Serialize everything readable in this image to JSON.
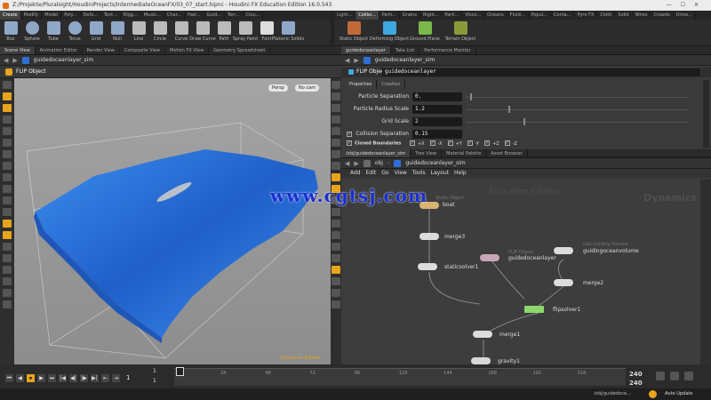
{
  "window": {
    "title": "Z:/Projekte/Pluralsight/HoudiniProjects/IntermediateOceanFX/03_07_start.hipnc - Houdini FX Education Edition 16.0.543"
  },
  "left_shelf": {
    "tabs": [
      "Create",
      "Modify",
      "Model",
      "Poly...",
      "Defo...",
      "Text...",
      "Rigg...",
      "Music...",
      "Char...",
      "Hair...",
      "Guid...",
      "Terr...",
      "Clou..."
    ],
    "tools": [
      "Box",
      "Sphere",
      "Tube",
      "Torus",
      "Grid",
      "Null",
      "Line",
      "Circle",
      "Curve",
      "Draw Curve",
      "Path",
      "Spray Paint",
      "Font",
      "Platonic Solids"
    ]
  },
  "right_shelf": {
    "tabs": [
      "Light...",
      "Collisi...",
      "Parti...",
      "Grains",
      "Rigid...",
      "Parti...",
      "Visco...",
      "Oceans",
      "Fluid...",
      "Popul...",
      "Conta...",
      "Pyro FX",
      "Cloth",
      "Solid",
      "Wires",
      "Crowds",
      "Drive..."
    ],
    "tools": [
      "Static Object",
      "Deforming Object",
      "Ground Plane",
      "Terrain Object"
    ]
  },
  "viewer": {
    "tabs": [
      "Scene View",
      "Animation Editor",
      "Render View",
      "Composite View",
      "Motion FX View",
      "Geometry Spreadsheet"
    ],
    "path": "guidedoceanlayer_sim",
    "title": "FLIP Object",
    "persp": "Persp",
    "cam": "No cam",
    "edu": "Education Edition"
  },
  "params_panel": {
    "tabs": [
      "guidedoceanlayer",
      "Take List",
      "Performance Monitor"
    ],
    "path": "guidedoceanlayer_sim",
    "node_type": "FLIP Object",
    "node_name": "guidedoceanlayer",
    "subtabs": [
      "Properties",
      "Creation"
    ],
    "rows": [
      {
        "label": "Particle Separation",
        "value": "0."
      },
      {
        "label": "Particle Radius Scale",
        "value": "1.2"
      },
      {
        "label": "Grid Scale",
        "value": "2"
      },
      {
        "label": "Collision Separation",
        "value": "0.15"
      }
    ],
    "closed_boundaries": "Closed Boundaries",
    "bounds": [
      "+X",
      "-X",
      "+Y",
      "-Y",
      "+Z",
      "-Z"
    ]
  },
  "network": {
    "tabs": [
      "/obj/guidedoceanlayer_sim",
      "Tree View",
      "Material Palette",
      "Asset Browser"
    ],
    "path_root": "obj",
    "path": "guidedoceanlayer_sim",
    "menu": [
      "Add",
      "Edit",
      "Go",
      "View",
      "Tools",
      "Layout",
      "Help"
    ],
    "edu_label": "Education Edition",
    "context_label": "Dynamics",
    "nodes": [
      {
        "name": "boat",
        "sub": "Static Object"
      },
      {
        "name": "merge3",
        "sub": ""
      },
      {
        "name": "guidedoceanlayer",
        "sub": "FLIP Object"
      },
      {
        "name": "guidingoceanvolume",
        "sub": "Gas Guiding Volume"
      },
      {
        "name": "merge2",
        "sub": ""
      },
      {
        "name": "staticsolver1",
        "sub": ""
      },
      {
        "name": "flipsolver1",
        "sub": ""
      },
      {
        "name": "merge1",
        "sub": ""
      },
      {
        "name": "gravity1",
        "sub": ""
      }
    ]
  },
  "watermark": "www.cgtsj.com",
  "timeline": {
    "frame": "1",
    "start_a": "1",
    "start_b": "1",
    "ticks": [
      "1",
      "24",
      "48",
      "72",
      "96",
      "120",
      "144",
      "168",
      "192",
      "216"
    ],
    "end_a": "240",
    "end_b": "240"
  },
  "status": {
    "path": "/obj/guidedoce...",
    "auto_update": "Auto Update"
  },
  "colors": {
    "accent": "#e8a41c",
    "water": "#2a73d8",
    "watermark": "#1a2fd0"
  }
}
